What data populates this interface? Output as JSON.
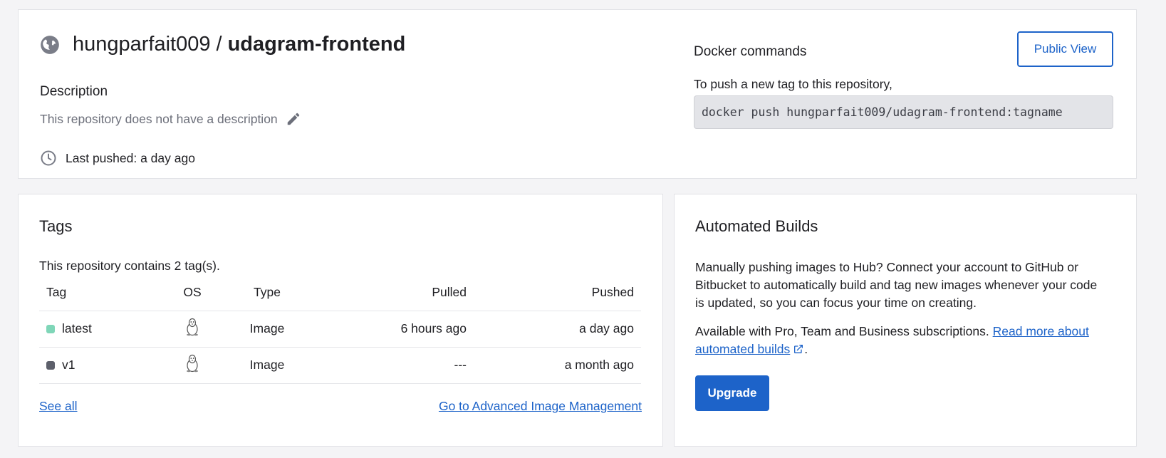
{
  "repo": {
    "namespace": "hungparfait009",
    "separator": "/",
    "name": "udagram-frontend",
    "description_heading": "Description",
    "description_text": "This repository does not have a description",
    "last_pushed": "Last pushed: a day ago"
  },
  "docker": {
    "heading": "Docker commands",
    "subtext": "To push a new tag to this repository,",
    "command": "docker push hungparfait009/udagram-frontend:tagname",
    "public_view_label": "Public View"
  },
  "tags": {
    "heading": "Tags",
    "count_text": "This repository contains 2 tag(s).",
    "columns": [
      "Tag",
      "OS",
      "Type",
      "Pulled",
      "Pushed"
    ],
    "rows": [
      {
        "tag": "latest",
        "os_icon": "linux-icon",
        "type": "Image",
        "pulled": "6 hours ago",
        "pushed": "a day ago",
        "color": "#7fd6b8"
      },
      {
        "tag": "v1",
        "os_icon": "linux-icon",
        "type": "Image",
        "pulled": "---",
        "pushed": "a month ago",
        "color": "#5d606b"
      }
    ],
    "see_all": "See all",
    "advanced_link": "Go to Advanced Image Management"
  },
  "builds": {
    "heading": "Automated Builds",
    "paragraph1": "Manually pushing images to Hub? Connect your account to GitHub or Bitbucket to automatically build and tag new images whenever your code is updated, so you can focus your time on creating.",
    "paragraph2_prefix": "Available with Pro, Team and Business subscriptions. ",
    "read_more_link": "Read more about automated builds",
    "paragraph2_suffix": ".",
    "upgrade_label": "Upgrade"
  },
  "colors": {
    "accent": "#1d63c9",
    "muted_text": "#6c6f7a",
    "code_bg": "#e3e4e8"
  }
}
